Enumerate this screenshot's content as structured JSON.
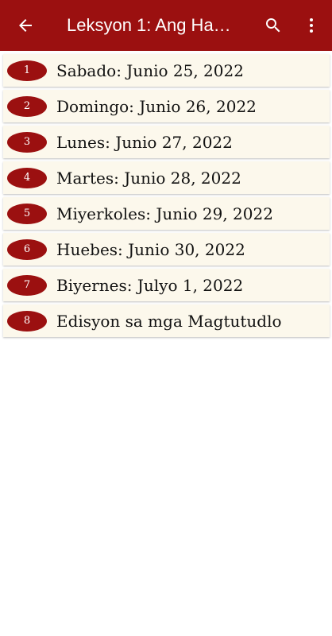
{
  "appbar": {
    "title": "Leksyon 1: Ang Ha…",
    "back_icon": "arrow-left-icon",
    "search_icon": "search-icon",
    "more_icon": "more-vert-icon"
  },
  "colors": {
    "primary": "#9b1010",
    "item_bg": "#fcf8ec"
  },
  "lessons": [
    {
      "num": "1",
      "label": "Sabado: Junio 25, 2022"
    },
    {
      "num": "2",
      "label": "Domingo: Junio 26, 2022"
    },
    {
      "num": "3",
      "label": "Lunes: Junio 27, 2022"
    },
    {
      "num": "4",
      "label": "Martes: Junio 28, 2022"
    },
    {
      "num": "5",
      "label": "Miyerkoles: Junio 29, 2022"
    },
    {
      "num": "6",
      "label": "Huebes: Junio 30, 2022"
    },
    {
      "num": "7",
      "label": "Biyernes: Julyo 1, 2022"
    },
    {
      "num": "8",
      "label": "Edisyon sa mga Magtutudlo"
    }
  ]
}
